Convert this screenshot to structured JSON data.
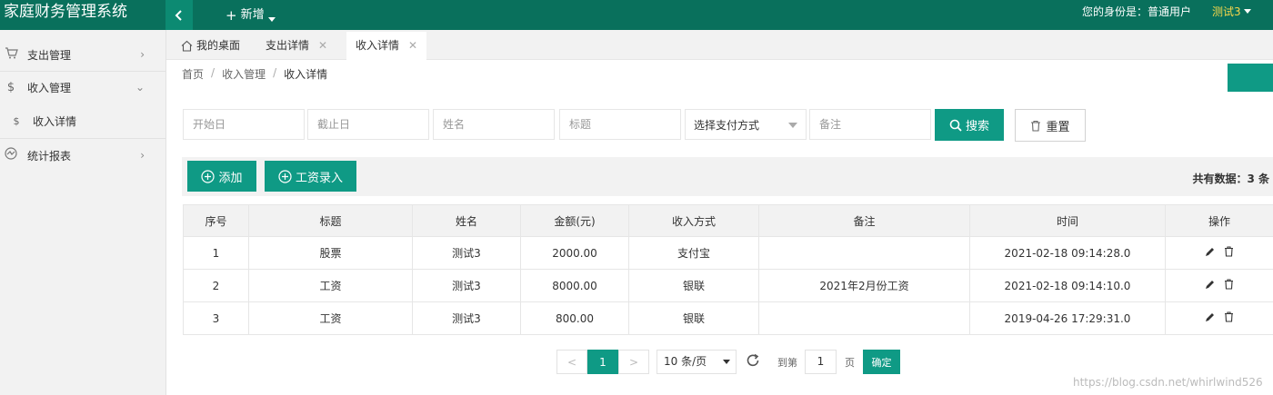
{
  "header": {
    "brand": "家庭财务管理系统",
    "new_label": "新增",
    "identity": "您的身份是：普通用户",
    "user": "测试3"
  },
  "sidebar": {
    "items": [
      {
        "label": "支出管理",
        "icon": "cart-icon"
      },
      {
        "label": "收入管理",
        "icon": "dollar-icon"
      },
      {
        "label": "收入详情",
        "icon": "dollar-icon"
      },
      {
        "label": "统计报表",
        "icon": "chart-icon"
      }
    ]
  },
  "tabs": [
    {
      "label": "我的桌面"
    },
    {
      "label": "支出详情"
    },
    {
      "label": "收入详情"
    }
  ],
  "breadcrumb": [
    "首页",
    "收入管理",
    "收入详情"
  ],
  "search": {
    "start_placeholder": "开始日",
    "end_placeholder": "截止日",
    "name_placeholder": "姓名",
    "title_placeholder": "标题",
    "payment_select": "选择支付方式",
    "remark_placeholder": "备注",
    "search_label": "搜索",
    "reset_label": "重置"
  },
  "toolbar": {
    "add_label": "添加",
    "salary_label": "工资录入",
    "total_label": "共有数据：",
    "total_count": "3",
    "total_unit": " 条"
  },
  "table": {
    "headers": [
      "序号",
      "标题",
      "姓名",
      "金额(元)",
      "收入方式",
      "备注",
      "时间",
      "操作"
    ],
    "rows": [
      {
        "no": "1",
        "title": "股票",
        "name": "测试3",
        "amount": "2000.00",
        "method": "支付宝",
        "remark": "",
        "time": "2021-02-18 09:14:28.0"
      },
      {
        "no": "2",
        "title": "工资",
        "name": "测试3",
        "amount": "8000.00",
        "method": "银联",
        "remark": "2021年2月份工资",
        "time": "2021-02-18 09:14:10.0"
      },
      {
        "no": "3",
        "title": "工资",
        "name": "测试3",
        "amount": "800.00",
        "method": "银联",
        "remark": "",
        "time": "2019-04-26 17:29:31.0"
      }
    ]
  },
  "pagination": {
    "prev": "<",
    "current": "1",
    "next": ">",
    "page_size": "10 条/页",
    "goto_label": "到第",
    "goto_value": "1",
    "page_label": "页",
    "confirm_label": "确定"
  },
  "watermark": "https://blog.csdn.net/whirlwind526",
  "colors": {
    "header_bg": "#09705c",
    "accent": "#0f9a85",
    "user_name": "#f7d74b"
  }
}
